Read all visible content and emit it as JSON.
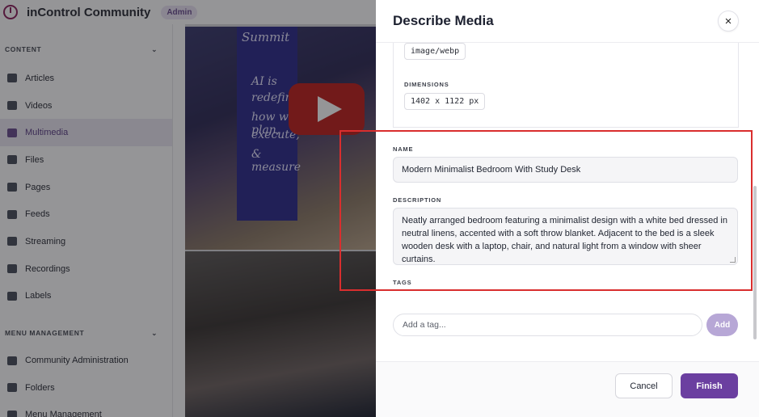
{
  "app": {
    "brand": "inControl Community",
    "badge": "Admin"
  },
  "sidebar": {
    "content_section": "CONTENT",
    "content_items": [
      {
        "label": "Articles",
        "icon": "articles-icon"
      },
      {
        "label": "Videos",
        "icon": "video-icon"
      },
      {
        "label": "Multimedia",
        "icon": "multimedia-icon",
        "active": true
      },
      {
        "label": "Files",
        "icon": "folder-icon"
      },
      {
        "label": "Pages",
        "icon": "layers-icon"
      },
      {
        "label": "Feeds",
        "icon": "feeds-icon"
      },
      {
        "label": "Streaming",
        "icon": "streaming-icon"
      },
      {
        "label": "Recordings",
        "icon": "recordings-icon"
      },
      {
        "label": "Labels",
        "icon": "tag-icon"
      }
    ],
    "menu_section": "MENU MANAGEMENT",
    "menu_items": [
      {
        "label": "Community Administration",
        "icon": "gear-icon"
      },
      {
        "label": "Folders",
        "icon": "folders-icon"
      },
      {
        "label": "Menu Management",
        "icon": "menu-icon"
      }
    ]
  },
  "media": {
    "banner_lines": [
      "Summit",
      "AI is",
      "redefining",
      "how we plan,",
      "execute,",
      "& measure"
    ]
  },
  "drawer": {
    "title": "Describe Media",
    "close_label": "×",
    "mime_type": "image/webp",
    "dimensions_label": "DIMENSIONS",
    "dimensions_value": "1402 x 1122 px",
    "name_label": "NAME",
    "name_value": "Modern Minimalist Bedroom With Study Desk",
    "description_label": "DESCRIPTION",
    "description_value": "Neatly arranged bedroom featuring a minimalist design with a white bed dressed in neutral linens, accented with a soft throw blanket. Adjacent to the bed is a sleek wooden desk with a laptop, chair, and natural light from a window with sheer curtains.",
    "tags_label": "TAGS",
    "tag_placeholder": "Add a tag...",
    "add_label": "Add",
    "cancel_label": "Cancel",
    "finish_label": "Finish"
  },
  "colors": {
    "accent": "#6b3fa0",
    "highlight": "#d92e2e"
  }
}
